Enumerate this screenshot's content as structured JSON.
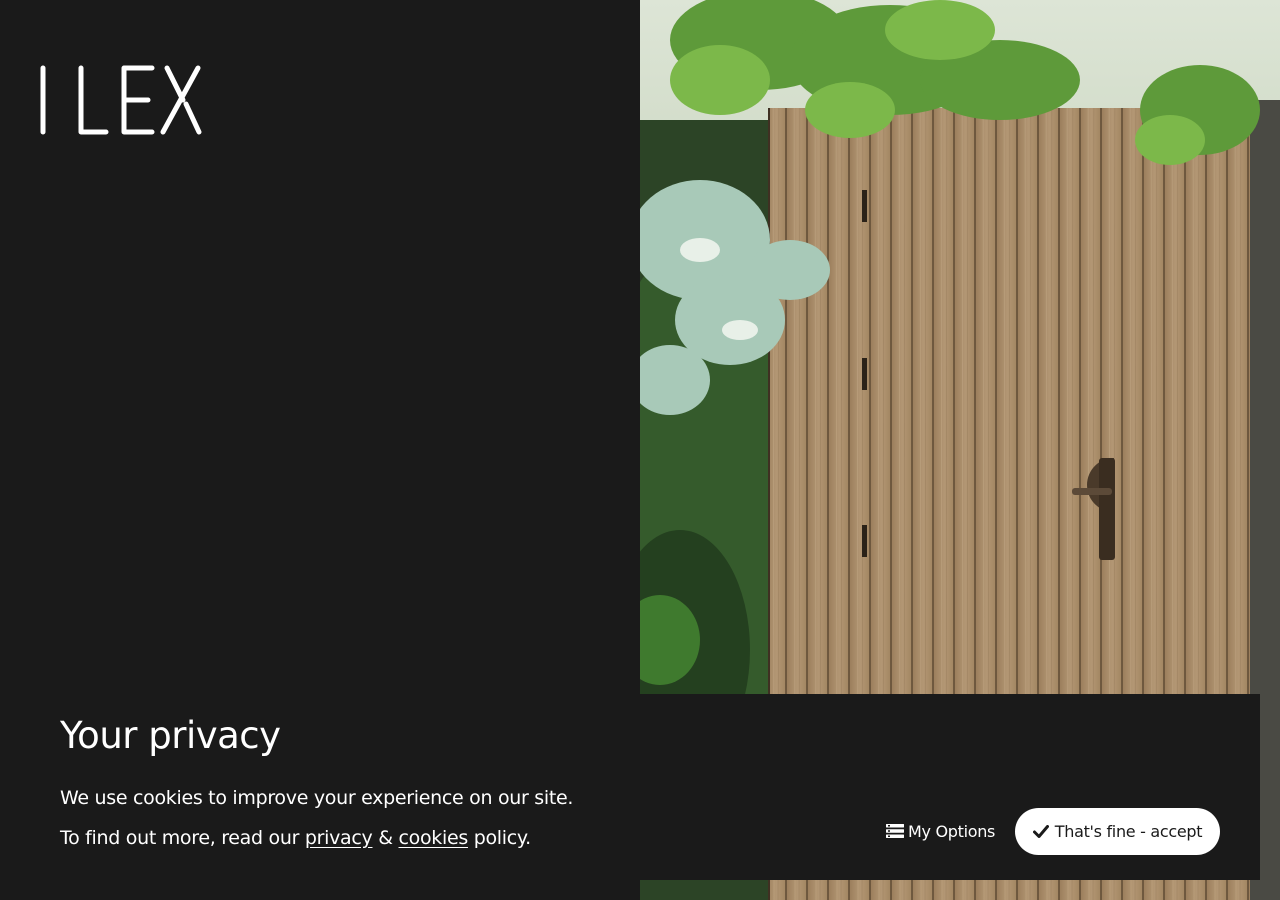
{
  "brand": {
    "logo_text": "ILEX"
  },
  "cookie_banner": {
    "title": "Your privacy",
    "line1": "We use cookies to improve your experience on our site.",
    "line2_prefix": "To find out more, read our ",
    "privacy_link": "privacy",
    "ampersand": " & ",
    "cookies_link": "cookies",
    "line2_suffix": " policy.",
    "options_label": "My Options",
    "accept_label": "That's fine - accept",
    "options_icon": "list-icon",
    "accept_icon": "check-icon"
  },
  "colors": {
    "background": "#1a1a1a",
    "text": "#ffffff",
    "accept_bg": "#ffffff",
    "accept_text": "#1a1a1a"
  }
}
